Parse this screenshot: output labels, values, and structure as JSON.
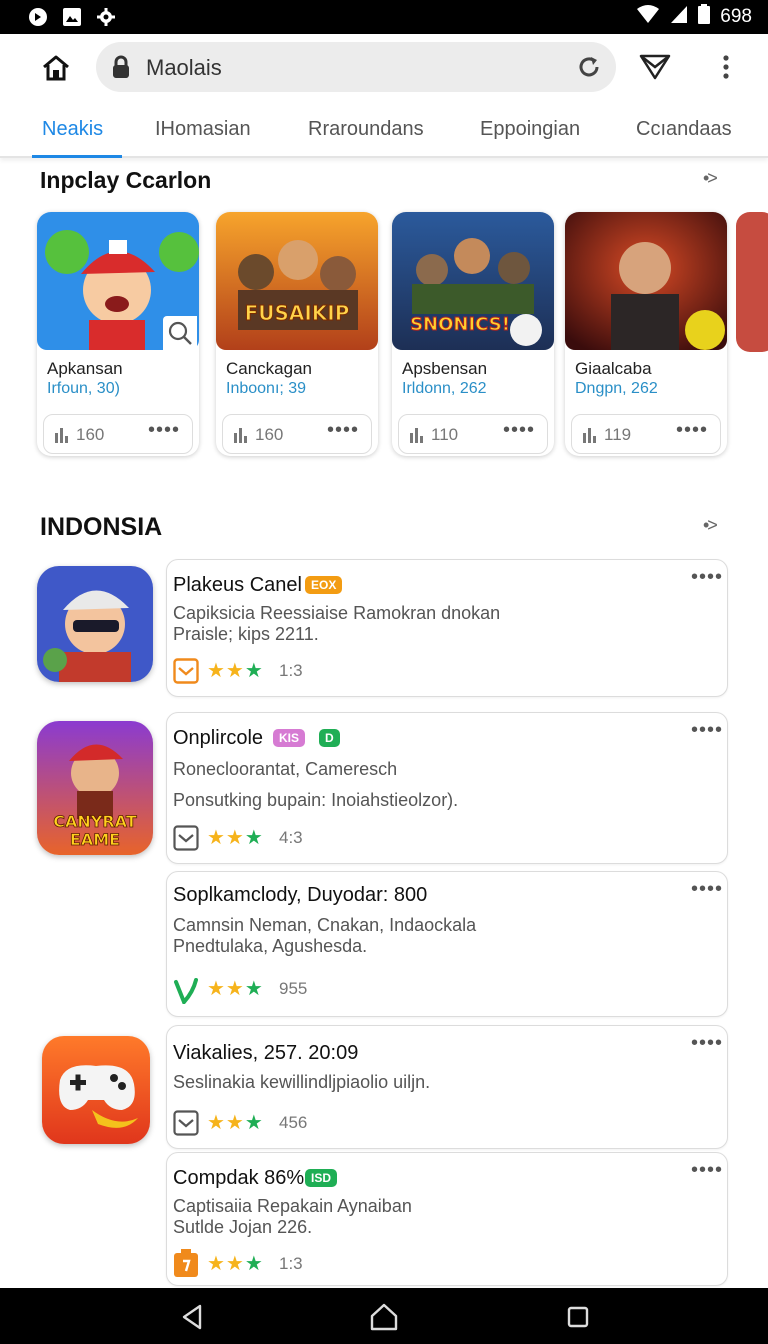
{
  "status_bar": {
    "time": "698",
    "icons_left": [
      "notification-icon",
      "image-icon",
      "settings-icon"
    ],
    "icons_right": [
      "wifi-icon",
      "signal-icon",
      "battery-icon"
    ]
  },
  "browser": {
    "address": "Maolais",
    "icons": [
      "home-icon",
      "lock-icon",
      "reload-icon",
      "send-icon",
      "more-vert-icon"
    ]
  },
  "tabs": [
    "Neakis",
    "IHomasian",
    "Rraroundans",
    "Eppoingian",
    "Ccıandaas"
  ],
  "active_tab": 0,
  "section1": {
    "title": "Inpclay Ccarlon",
    "more": "•>",
    "cards": [
      {
        "name": "Apkansan",
        "sub": "Irfoun, 30)",
        "stat": "160",
        "dots": "••••"
      },
      {
        "name": "Canckagan",
        "sub": "Inboonı; 39",
        "stat": "160",
        "dots": "••••"
      },
      {
        "name": "Apsbensan",
        "sub": "Irldonn, 262",
        "stat": "110",
        "dots": "••••"
      },
      {
        "name": "Giaalcaba",
        "sub": "Dngpn, 262",
        "stat": "119",
        "dots": "••••"
      }
    ],
    "thumb_texts": [
      "FUSAIKIP",
      "SNONICS!"
    ]
  },
  "section2": {
    "title": "INDONSIA",
    "more": "•>",
    "rows": [
      {
        "title": "Plakeus Canel",
        "badges": [
          {
            "text": "EOX",
            "color": "#f39c12"
          }
        ],
        "desc": [
          "Capiksicia Reessiaise Ramokran dnokan",
          "Praisle; kips 2211."
        ],
        "rating": "1:3",
        "dots": "••••"
      },
      {
        "title": "Onplircole",
        "badges": [
          {
            "text": "KIS",
            "color": "#d67bd3"
          },
          {
            "text": "D",
            "color": "#1fae55"
          }
        ],
        "desc": [
          "Ronecloorantat, Cameresch",
          "Ponsutking bupain: Inoiahstieolzor)."
        ],
        "rating": "4:3",
        "dots": "••••"
      },
      {
        "title": "Soplkamclody, Duyodar: 800",
        "badges": [],
        "desc": [
          "Camnsin Neman, Cnakan, Indaockala",
          "Pnedtulaka, Agushesda."
        ],
        "rating": "955",
        "dots": "••••"
      },
      {
        "title": "Viakalies, 257. 20:09",
        "badges": [],
        "desc": [
          "Seslinakia kewillindljpiaolio uiljn."
        ],
        "rating": "456",
        "dots": "••••"
      },
      {
        "title": "Compdak 86%",
        "badges": [
          {
            "text": "ISD",
            "color": "#1fae55"
          }
        ],
        "desc": [
          "Captisaiia Repakain Aynaiban",
          "Sutlde Jojan 226."
        ],
        "rating": "1:3",
        "dots": "••••"
      }
    ],
    "icon_texts": [
      "CANYRAT",
      "EAME"
    ]
  },
  "colors": {
    "accent": "#1e88e5",
    "link": "#2a8fc7",
    "star": "#f6b31b",
    "star_green": "#1fae55"
  },
  "stars": "★★★"
}
